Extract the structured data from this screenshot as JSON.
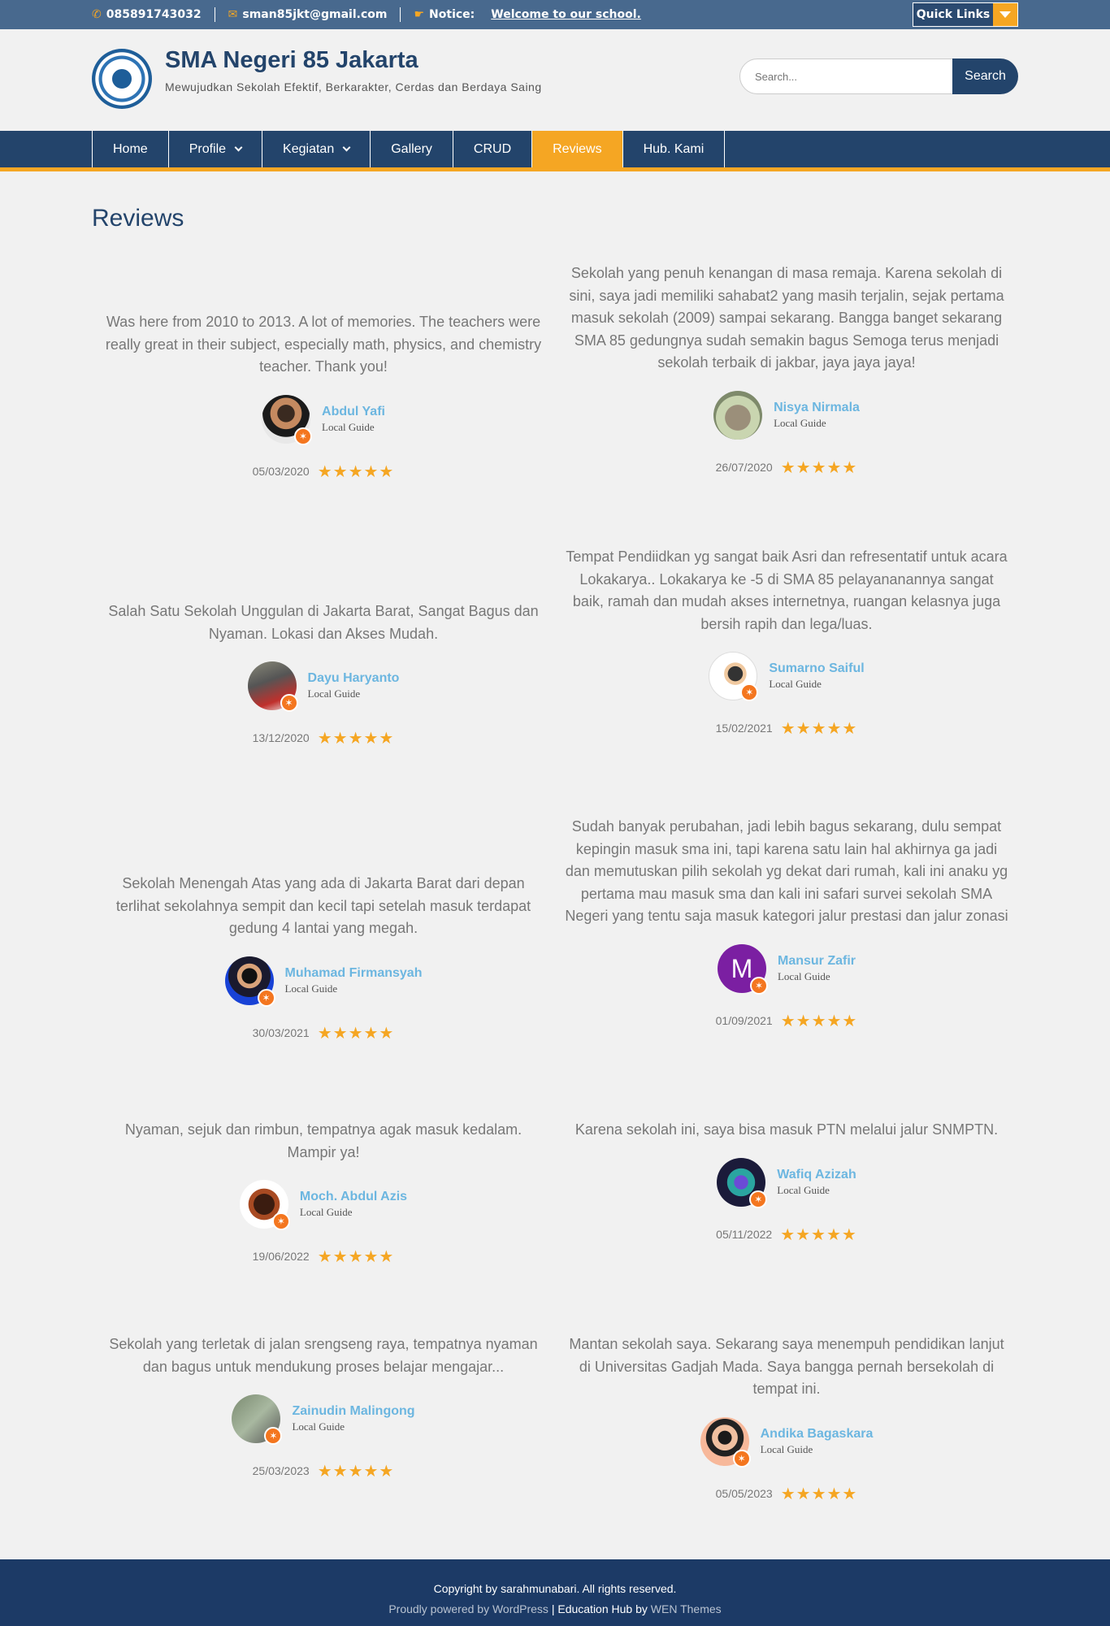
{
  "topbar": {
    "phone": "085891743032",
    "email": "sman85jkt@gmail.com",
    "notice_label": "Notice:",
    "notice_text": "Welcome to our school.",
    "quick_links": "Quick Links"
  },
  "header": {
    "title": "SMA Negeri 85 Jakarta",
    "tagline": "Mewujudkan Sekolah Efektif, Berkarakter, Cerdas dan Berdaya Saing",
    "search_placeholder": "Search...",
    "search_button": "Search"
  },
  "nav": [
    {
      "label": "Home"
    },
    {
      "label": "Profile"
    },
    {
      "label": "Kegiatan"
    },
    {
      "label": "Gallery"
    },
    {
      "label": "CRUD"
    },
    {
      "label": "Reviews"
    },
    {
      "label": "Hub. Kami"
    }
  ],
  "page_title": "Reviews",
  "reviews": [
    {
      "text": "Was here from 2010 to 2013. A lot of memories. The teachers were really great in their subject, especially math, physics, and chemistry teacher. Thank you!",
      "name": "Abdul Yafi",
      "guide": "Local Guide",
      "date": "05/03/2020",
      "stars": "★★★★★"
    },
    {
      "text": "Sekolah yang penuh kenangan di masa remaja. Karena sekolah di sini, saya jadi memiliki sahabat2 yang masih terjalin, sejak pertama masuk sekolah (2009) sampai sekarang. Bangga banget sekarang SMA 85 gedungnya sudah semakin bagus Semoga terus menjadi sekolah terbaik di jakbar, jaya jaya jaya!",
      "name": "Nisya Nirmala",
      "guide": "Local Guide",
      "date": "26/07/2020",
      "stars": "★★★★★"
    },
    {
      "text": "Salah Satu Sekolah Unggulan di Jakarta Barat, Sangat Bagus dan Nyaman. Lokasi dan Akses Mudah.",
      "name": "Dayu Haryanto",
      "guide": "Local Guide",
      "date": "13/12/2020",
      "stars": "★★★★★"
    },
    {
      "text": "Tempat Pendiidkan yg sangat baik Asri dan refresentatif untuk acara Lokakarya.. Lokakarya ke -5 di SMA 85 pelayananannya sangat baik, ramah dan mudah akses internetnya, ruangan kelasnya juga bersih rapih dan lega/luas.",
      "name": "Sumarno Saiful",
      "guide": "Local Guide",
      "date": "15/02/2021",
      "stars": "★★★★★"
    },
    {
      "text": "Sekolah Menengah Atas yang ada di Jakarta Barat dari depan terlihat sekolahnya sempit dan kecil tapi setelah masuk terdapat gedung 4 lantai yang megah.",
      "name": "Muhamad Firmansyah",
      "guide": "Local Guide",
      "date": "30/03/2021",
      "stars": "★★★★★"
    },
    {
      "text": "Sudah banyak perubahan, jadi lebih bagus sekarang, dulu sempat kepingin masuk sma ini, tapi karena satu lain hal akhirnya ga jadi dan memutuskan pilih sekolah yg dekat dari rumah, kali ini anaku yg pertama mau masuk sma dan kali ini safari survei sekolah SMA Negeri yang tentu saja masuk kategori jalur prestasi dan jalur zonasi",
      "name": "Mansur Zafir",
      "guide": "Local Guide",
      "date": "01/09/2021",
      "stars": "★★★★★",
      "initial": "M"
    },
    {
      "text": "Nyaman, sejuk dan rimbun, tempatnya agak masuk kedalam. Mampir ya!",
      "name": "Moch. Abdul Azis",
      "guide": "Local Guide",
      "date": "19/06/2022",
      "stars": "★★★★★"
    },
    {
      "text": "Karena sekolah ini, saya bisa masuk PTN melalui jalur SNMPTN.",
      "name": "Wafiq Azizah",
      "guide": "Local Guide",
      "date": "05/11/2022",
      "stars": "★★★★★"
    },
    {
      "text": "Sekolah yang terletak di jalan srengseng raya, tempatnya nyaman dan bagus untuk mendukung proses belajar mengajar...",
      "name": "Zainudin Malingong",
      "guide": "Local Guide",
      "date": "25/03/2023",
      "stars": "★★★★★"
    },
    {
      "text": "Mantan sekolah saya. Sekarang saya menempuh pendidikan lanjut di Universitas Gadjah Mada. Saya bangga pernah bersekolah di tempat ini.",
      "name": "Andika Bagaskara",
      "guide": "Local Guide",
      "date": "05/05/2023",
      "stars": "★★★★★"
    }
  ],
  "footer": {
    "copyright": "Copyright by sarahmunabari. All rights reserved.",
    "powered_by": "Proudly powered by WordPress",
    "separator": "|",
    "theme": "Education Hub",
    "by": "by",
    "author": "WEN Themes"
  },
  "colors": {
    "primary": "#23446b",
    "accent": "#f5a623",
    "topbar": "#48698e",
    "name": "#6cb6e0"
  }
}
